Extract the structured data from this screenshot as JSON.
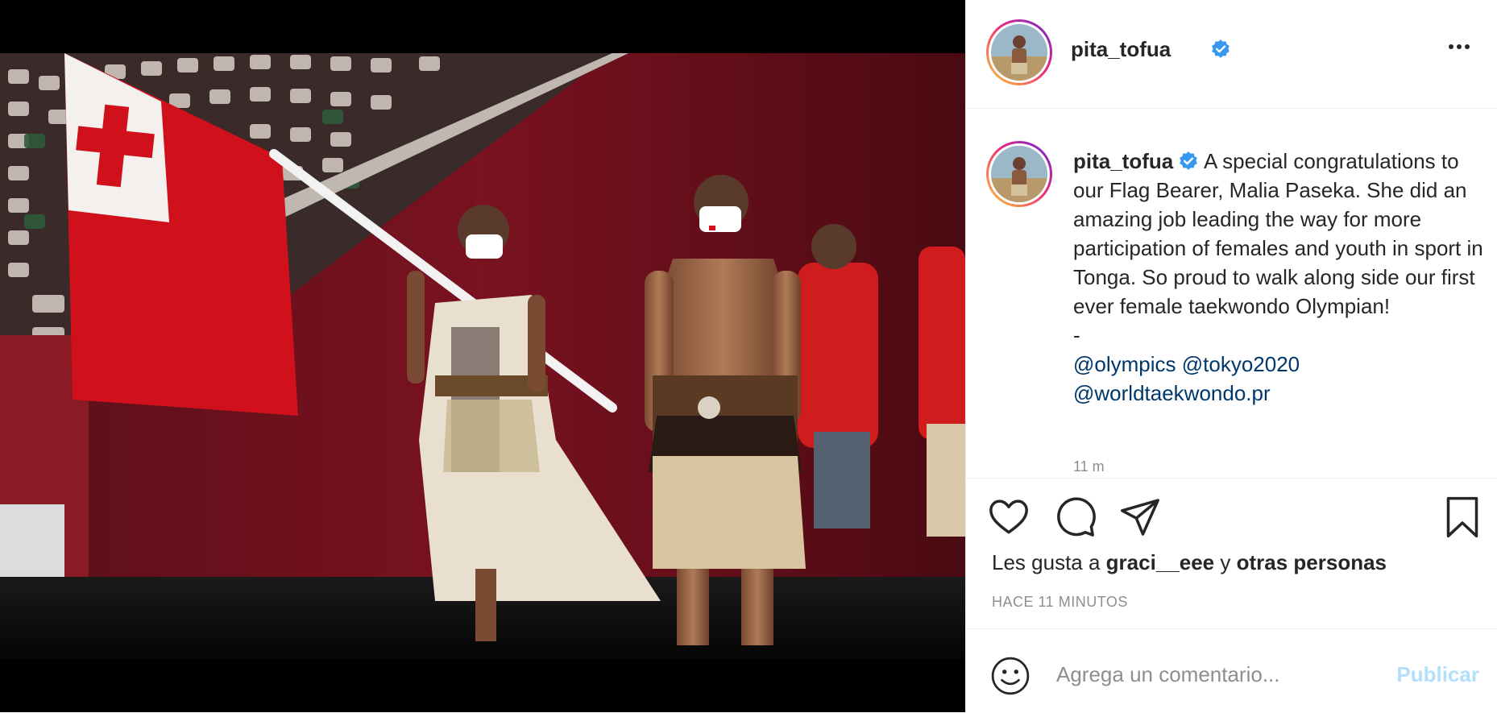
{
  "post": {
    "username": "pita_tofua",
    "verified": true,
    "more_icon": "more-horizontal-icon"
  },
  "caption": {
    "username": "pita_tofua",
    "text": "A special congratulations to our Flag Bearer, Malia Paseka. She did an amazing job leading the way for more participation of females and youth in sport in Tonga. So proud to walk along side our first ever female taekwondo Olympian!",
    "separator": "-",
    "mentions": [
      "@olympics",
      "@tokyo2020",
      "@worldtaekwondo.pr"
    ],
    "time_ago": "11 m"
  },
  "actions": {
    "like_icon": "heart-icon",
    "comment_icon": "comment-icon",
    "share_icon": "paper-plane-icon",
    "save_icon": "bookmark-icon"
  },
  "likes": {
    "prefix": "Les gusta a",
    "user": "graci__eee",
    "connector": "y",
    "others": "otras personas"
  },
  "timestamp": "HACE 11 MINUTOS",
  "comment": {
    "placeholder": "Agrega un comentario...",
    "publish_label": "Publicar",
    "emoji_icon": "smiley-icon"
  },
  "colors": {
    "link": "#00376b",
    "verified": "#3897f0",
    "publish_disabled": "#b2dffc",
    "muted": "#8e8e8e",
    "tonga_red": "#c10000"
  }
}
